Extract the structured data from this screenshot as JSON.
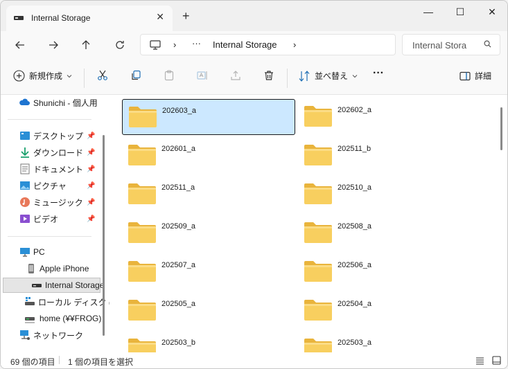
{
  "tab": {
    "title": "Internal Storage"
  },
  "window_controls": {
    "minimize": "—",
    "maximize": "☐",
    "close": "✕"
  },
  "address": {
    "ellipsis": "···",
    "location": "Internal Storage",
    "separator": "›"
  },
  "search": {
    "placeholder": "Internal Stora"
  },
  "toolbar": {
    "new_label": "新規作成",
    "sort_label": "並べ替え",
    "more": "···",
    "details_label": "詳細"
  },
  "sidebar": {
    "cloud": "Shunichi - 個人用",
    "quick": [
      {
        "label": "デスクトップ",
        "icon": "desktop-icon"
      },
      {
        "label": "ダウンロード",
        "icon": "download-icon"
      },
      {
        "label": "ドキュメント",
        "icon": "documents-icon"
      },
      {
        "label": "ピクチャ",
        "icon": "pictures-icon"
      },
      {
        "label": "ミュージック",
        "icon": "music-icon"
      },
      {
        "label": "ビデオ",
        "icon": "videos-icon"
      }
    ],
    "pc": "PC",
    "device": "Apple iPhone",
    "storage": "Internal Storage",
    "local_disk": "ローカル ディスク (C",
    "home": "home (¥¥FROG)",
    "network": "ネットワーク"
  },
  "folders": [
    "202603_a",
    "202602_a",
    "202601_a",
    "202511_b",
    "202511_a",
    "202510_a",
    "202509_a",
    "202508_a",
    "202507_a",
    "202506_a",
    "202505_a",
    "202504_a",
    "202503_b",
    "202503_a"
  ],
  "status": {
    "count": "69 個の項目",
    "selected": "1 個の項目を選択"
  },
  "colors": {
    "selection": "#cce8ff",
    "folder": "#f8cf5f",
    "accent": "#0067c0"
  }
}
